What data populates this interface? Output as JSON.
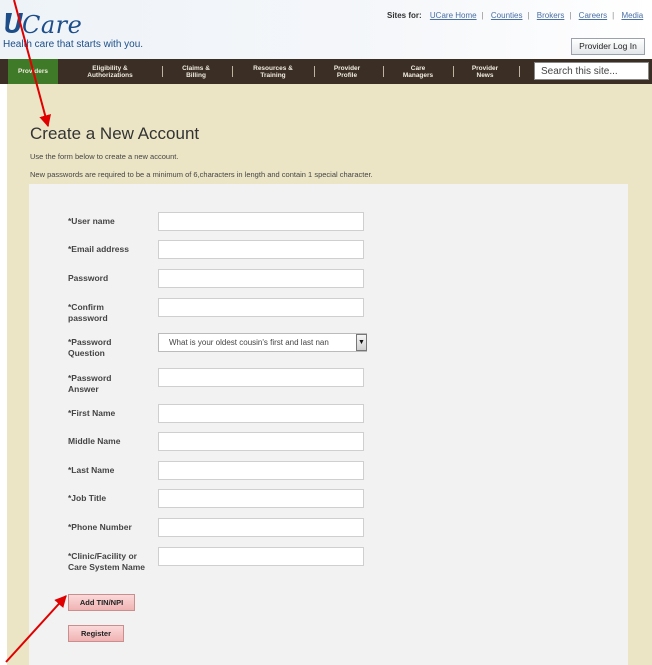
{
  "header": {
    "logo_text": "Care",
    "tagline": "Health care that starts with you.",
    "sites_label": "Sites for:",
    "sites_links": [
      "UCare Home",
      "Counties",
      "Brokers",
      "Careers",
      "Media"
    ],
    "login_button": "Provider Log In"
  },
  "nav": {
    "items": [
      "Providers",
      "Eligibility & Authorizations",
      "Claims & Billing",
      "Resources & Training",
      "Provider Profile",
      "Care Managers",
      "Provider News"
    ],
    "search_placeholder": "Search this site..."
  },
  "page": {
    "title": "Create a New Account",
    "intro": "Use the form below to create a new account.",
    "password_rule": "New passwords are required to be a minimum of 6,characters in length and contain 1 special character."
  },
  "form": {
    "fields": [
      "*User name",
      "*Email address",
      "Password",
      "*Confirm password",
      "*Password Question",
      "*Password Answer",
      "*First Name",
      "Middle Name",
      "*Last Name",
      "*Job Title",
      "*Phone Number",
      "*Clinic/Facility or Care System Name"
    ],
    "password_question_value": "What is your oldest cousin's first and last nan",
    "add_tin_button": "Add TIN/NPI",
    "register_button": "Register"
  },
  "colors": {
    "nav_bg": "#3b2f25",
    "nav_active": "#3e7a27",
    "content_bg": "#ebe5c6",
    "form_bg": "#f2f2f2",
    "button_bg": "#f0b3b3",
    "annotation_arrow": "#e00000",
    "brand_blue": "#1d4e89"
  }
}
